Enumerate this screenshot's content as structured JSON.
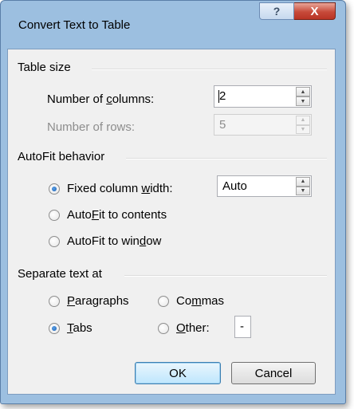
{
  "window": {
    "title": "Convert Text to Table",
    "help_icon": "?",
    "close_icon": "X"
  },
  "table_size": {
    "title": "Table size",
    "columns": {
      "pre": "Number of ",
      "key": "c",
      "post": "olumns:",
      "value": "2"
    },
    "rows": {
      "label": "Number of rows:",
      "value": "5"
    }
  },
  "autofit": {
    "title": "AutoFit behavior",
    "fixed": {
      "pre": "Fixed column ",
      "key": "w",
      "post": "idth:",
      "value": "Auto",
      "selected": true
    },
    "contents": {
      "pre": "Auto",
      "key": "F",
      "post": "it to contents",
      "selected": false
    },
    "window": {
      "pre": "AutoFit to win",
      "key": "d",
      "post": "ow",
      "selected": false
    }
  },
  "separate": {
    "title": "Separate text at",
    "paragraphs": {
      "pre": "",
      "key": "P",
      "post": "aragraphs",
      "selected": false
    },
    "commas": {
      "pre": "Co",
      "key": "m",
      "post": "mas",
      "selected": false
    },
    "tabs": {
      "pre": "",
      "key": "T",
      "post": "abs",
      "selected": true
    },
    "other": {
      "pre": "",
      "key": "O",
      "post": "ther:",
      "value": "-",
      "selected": false
    }
  },
  "buttons": {
    "ok": "OK",
    "cancel": "Cancel"
  }
}
